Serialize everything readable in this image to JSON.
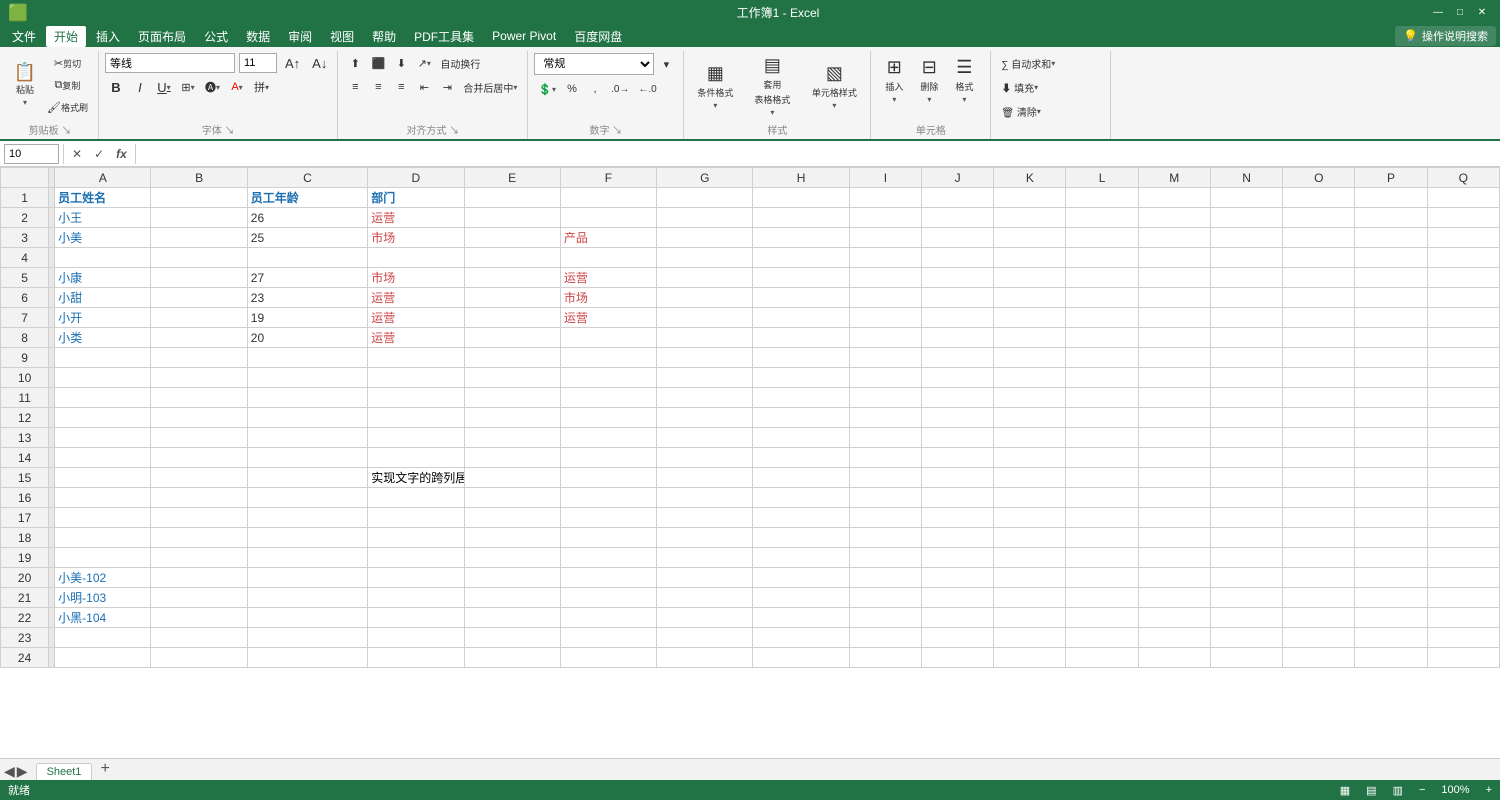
{
  "titleBar": {
    "filename": "工作簿1 - Excel",
    "windowControls": [
      "—",
      "□",
      "✕"
    ]
  },
  "menuBar": {
    "items": [
      "文件",
      "开始",
      "插入",
      "页面布局",
      "公式",
      "数据",
      "审阅",
      "视图",
      "帮助",
      "PDF工具集",
      "Power Pivot",
      "百度网盘"
    ],
    "activeItem": "开始",
    "searchPlaceholder": "操作说明搜索",
    "helpIcon": "💡"
  },
  "ribbon": {
    "groups": [
      {
        "label": "剪贴板",
        "items": [
          "粘贴",
          "剪切",
          "复制",
          "格式刷"
        ]
      },
      {
        "label": "字体",
        "fontName": "等线",
        "fontSize": "11",
        "items": [
          "B",
          "I",
          "U",
          "边框",
          "填充色",
          "字体色",
          "增大字号",
          "减小字号"
        ]
      },
      {
        "label": "对齐方式",
        "items": [
          "顶端对齐",
          "垂直居中",
          "底端对齐",
          "左对齐",
          "居中",
          "右对齐",
          "自动换行",
          "合并后居中",
          "减少缩进",
          "增加缩进"
        ]
      },
      {
        "label": "数字",
        "format": "常规",
        "items": [
          "%",
          "千位分隔",
          "增加小数",
          "减少小数"
        ]
      },
      {
        "label": "样式",
        "items": [
          "条件格式",
          "套用表格格式",
          "单元格样式"
        ]
      },
      {
        "label": "单元格",
        "items": [
          "插入",
          "删除",
          "格式"
        ]
      },
      {
        "label": "",
        "items": [
          "自动求和",
          "填充",
          "清除"
        ]
      }
    ]
  },
  "formulaBar": {
    "cellRef": "10",
    "cancelLabel": "✕",
    "confirmLabel": "✓",
    "functionLabel": "fx",
    "formula": ""
  },
  "columnHeaders": [
    "A",
    "B",
    "C",
    "D",
    "E",
    "F",
    "G",
    "H",
    "I",
    "J",
    "K",
    "L",
    "M",
    "N",
    "O",
    "P",
    "Q"
  ],
  "rows": [
    {
      "num": "1",
      "a": "员工姓名",
      "b": "",
      "c": "员工年龄",
      "d": "部门",
      "e": "",
      "f": "",
      "g": "",
      "h": "",
      "i": "",
      "j": "",
      "k": "",
      "l": "",
      "m": "",
      "n": "",
      "o": "",
      "p": "",
      "q": ""
    },
    {
      "num": "2",
      "a": "小王",
      "b": "",
      "c": "26",
      "d": "运营",
      "e": "",
      "f": "",
      "g": "",
      "h": "",
      "i": "",
      "j": "",
      "k": "",
      "l": "",
      "m": "",
      "n": "",
      "o": "",
      "p": "",
      "q": ""
    },
    {
      "num": "3",
      "a": "小美",
      "b": "",
      "c": "25",
      "d": "市场",
      "e": "",
      "f": "产品",
      "g": "",
      "h": "",
      "i": "",
      "j": "",
      "k": "",
      "l": "",
      "m": "",
      "n": "",
      "o": "",
      "p": "",
      "q": ""
    },
    {
      "num": "4",
      "a": "",
      "b": "",
      "c": "",
      "d": "",
      "e": "",
      "f": "",
      "g": "",
      "h": "",
      "i": "",
      "j": "",
      "k": "",
      "l": "",
      "m": "",
      "n": "",
      "o": "",
      "p": "",
      "q": ""
    },
    {
      "num": "5",
      "a": "小康",
      "b": "",
      "c": "27",
      "d": "市场",
      "e": "",
      "f": "运营",
      "g": "",
      "h": "",
      "i": "",
      "j": "",
      "k": "",
      "l": "",
      "m": "",
      "n": "",
      "o": "",
      "p": "",
      "q": ""
    },
    {
      "num": "6",
      "a": "小甜",
      "b": "",
      "c": "23",
      "d": "运营",
      "e": "",
      "f": "市场",
      "g": "",
      "h": "",
      "i": "",
      "j": "",
      "k": "",
      "l": "",
      "m": "",
      "n": "",
      "o": "",
      "p": "",
      "q": ""
    },
    {
      "num": "7",
      "a": "小开",
      "b": "",
      "c": "19",
      "d": "运营",
      "e": "",
      "f": "运营",
      "g": "",
      "h": "",
      "i": "",
      "j": "",
      "k": "",
      "l": "",
      "m": "",
      "n": "",
      "o": "",
      "p": "",
      "q": ""
    },
    {
      "num": "8",
      "a": "小类",
      "b": "",
      "c": "20",
      "d": "运营",
      "e": "",
      "f": "",
      "g": "",
      "h": "",
      "i": "",
      "j": "",
      "k": "",
      "l": "",
      "m": "",
      "n": "",
      "o": "",
      "p": "",
      "q": ""
    },
    {
      "num": "9",
      "a": "",
      "b": "",
      "c": "",
      "d": "",
      "e": "",
      "f": "",
      "g": "",
      "h": "",
      "i": "",
      "j": "",
      "k": "",
      "l": "",
      "m": "",
      "n": "",
      "o": "",
      "p": "",
      "q": ""
    },
    {
      "num": "10",
      "a": "",
      "b": "",
      "c": "",
      "d": "",
      "e": "",
      "f": "",
      "g": "",
      "h": "",
      "i": "",
      "j": "",
      "k": "",
      "l": "",
      "m": "",
      "n": "",
      "o": "",
      "p": "",
      "q": ""
    },
    {
      "num": "11",
      "a": "",
      "b": "",
      "c": "",
      "d": "",
      "e": "",
      "f": "",
      "g": "",
      "h": "",
      "i": "",
      "j": "",
      "k": "",
      "l": "",
      "m": "",
      "n": "",
      "o": "",
      "p": "",
      "q": ""
    },
    {
      "num": "12",
      "a": "",
      "b": "",
      "c": "",
      "d": "",
      "e": "",
      "f": "",
      "g": "",
      "h": "",
      "i": "",
      "j": "",
      "k": "",
      "l": "",
      "m": "",
      "n": "",
      "o": "",
      "p": "",
      "q": ""
    },
    {
      "num": "13",
      "a": "",
      "b": "",
      "c": "",
      "d": "",
      "e": "",
      "f": "",
      "g": "",
      "h": "",
      "i": "",
      "j": "",
      "k": "",
      "l": "",
      "m": "",
      "n": "",
      "o": "",
      "p": "",
      "q": ""
    },
    {
      "num": "14",
      "a": "",
      "b": "",
      "c": "",
      "d": "",
      "e": "",
      "f": "",
      "g": "",
      "h": "",
      "i": "",
      "j": "",
      "k": "",
      "l": "",
      "m": "",
      "n": "",
      "o": "",
      "p": "",
      "q": ""
    },
    {
      "num": "15",
      "a": "",
      "b": "",
      "c": "",
      "d": "实现文字的跨列居中显示",
      "e": "",
      "f": "",
      "g": "",
      "h": "",
      "i": "",
      "j": "",
      "k": "",
      "l": "",
      "m": "",
      "n": "",
      "o": "",
      "p": "",
      "q": ""
    },
    {
      "num": "16",
      "a": "",
      "b": "",
      "c": "",
      "d": "",
      "e": "",
      "f": "",
      "g": "",
      "h": "",
      "i": "",
      "j": "",
      "k": "",
      "l": "",
      "m": "",
      "n": "",
      "o": "",
      "p": "",
      "q": ""
    },
    {
      "num": "17",
      "a": "",
      "b": "",
      "c": "",
      "d": "",
      "e": "",
      "f": "",
      "g": "",
      "h": "",
      "i": "",
      "j": "",
      "k": "",
      "l": "",
      "m": "",
      "n": "",
      "o": "",
      "p": "",
      "q": ""
    },
    {
      "num": "18",
      "a": "",
      "b": "",
      "c": "",
      "d": "",
      "e": "",
      "f": "",
      "g": "",
      "h": "",
      "i": "",
      "j": "",
      "k": "",
      "l": "",
      "m": "",
      "n": "",
      "o": "",
      "p": "",
      "q": ""
    },
    {
      "num": "19",
      "a": "",
      "b": "",
      "c": "",
      "d": "",
      "e": "",
      "f": "",
      "g": "",
      "h": "",
      "i": "",
      "j": "",
      "k": "",
      "l": "",
      "m": "",
      "n": "",
      "o": "",
      "p": "",
      "q": ""
    },
    {
      "num": "20",
      "a": "小美-102",
      "b": "",
      "c": "",
      "d": "",
      "e": "",
      "f": "",
      "g": "",
      "h": "",
      "i": "",
      "j": "",
      "k": "",
      "l": "",
      "m": "",
      "n": "",
      "o": "",
      "p": "",
      "q": ""
    },
    {
      "num": "21",
      "a": "小明-103",
      "b": "",
      "c": "",
      "d": "",
      "e": "",
      "f": "",
      "g": "",
      "h": "",
      "i": "",
      "j": "",
      "k": "",
      "l": "",
      "m": "",
      "n": "",
      "o": "",
      "p": "",
      "q": ""
    },
    {
      "num": "22",
      "a": "小黑-104",
      "b": "",
      "c": "",
      "d": "",
      "e": "",
      "f": "",
      "g": "",
      "h": "",
      "i": "",
      "j": "",
      "k": "",
      "l": "",
      "m": "",
      "n": "",
      "o": "",
      "p": "",
      "q": ""
    },
    {
      "num": "23",
      "a": "",
      "b": "",
      "c": "",
      "d": "",
      "e": "",
      "f": "",
      "g": "",
      "h": "",
      "i": "",
      "j": "",
      "k": "",
      "l": "",
      "m": "",
      "n": "",
      "o": "",
      "p": "",
      "q": ""
    },
    {
      "num": "24",
      "a": "",
      "b": "",
      "c": "",
      "d": "",
      "e": "",
      "f": "",
      "g": "",
      "h": "",
      "i": "",
      "j": "",
      "k": "",
      "l": "",
      "m": "",
      "n": "",
      "o": "",
      "p": "",
      "q": ""
    }
  ],
  "sheetTabs": [
    "Sheet1"
  ],
  "statusBar": {
    "items": [
      "就绪",
      ""
    ]
  },
  "colors": {
    "excelGreen": "#217346",
    "headerBg": "#f2f2f2",
    "selectedCell": "#cce8ff",
    "textBlue": "#1a6fb3",
    "textRed": "#cc4444"
  }
}
